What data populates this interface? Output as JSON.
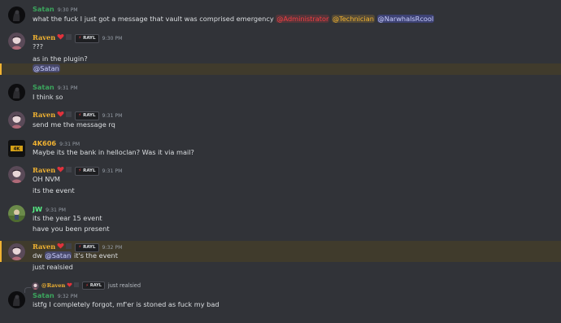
{
  "colors": {
    "background": "#313338",
    "text": "#dbdee1",
    "timestamp": "#949ba4",
    "satan": "#3ba55d",
    "raven": "#f0b232",
    "k606": "#f0b232",
    "jw": "#57f287",
    "highlight_bg": "#403b2c",
    "highlight_bar": "#f0b232",
    "mention_red": "#f23f43",
    "mention_yellow": "#f0b232",
    "mention_blue": "#c9cdfb"
  },
  "messages": [
    {
      "author": "Satan",
      "time": "9:30 PM",
      "lines": [
        "what the fuck I just got a message that vault was comprised emergency"
      ],
      "mentions": [
        "@Administrator",
        "@Technician",
        "@NarwhalsRcool"
      ]
    },
    {
      "author": "Raven",
      "tag": "RAYL",
      "time": "9:30 PM",
      "lines": [
        "???",
        "as in the plugin?"
      ],
      "mention_line": "@Satan"
    },
    {
      "author": "Satan",
      "time": "9:31 PM",
      "lines": [
        "I think so"
      ]
    },
    {
      "author": "Raven",
      "tag": "RAYL",
      "time": "9:31 PM",
      "lines": [
        "send me the message rq"
      ]
    },
    {
      "author": "4K606",
      "time": "9:31 PM",
      "lines": [
        "Maybe its the bank in helloclan? Was it via mail?"
      ]
    },
    {
      "author": "Raven",
      "tag": "RAYL",
      "time": "9:31 PM",
      "lines": [
        "OH NVM",
        "its the event"
      ]
    },
    {
      "author": "JW",
      "time": "9:31 PM",
      "lines": [
        "its the year 15 event",
        "have you been present"
      ]
    },
    {
      "author": "Raven",
      "tag": "RAYL",
      "time": "9:32 PM",
      "line1_prefix": "dw",
      "line1_mention": "@Satan",
      "line1_suffix": "it's the event",
      "lines": [
        "just realsied"
      ]
    },
    {
      "author": "Satan",
      "time": "9:32 PM",
      "reply": {
        "author": "@Raven",
        "tag": "RAYL",
        "text": "just realsied"
      },
      "lines": [
        "istfg I completely forgot, mf'er is stoned as fuck my bad"
      ]
    }
  ],
  "avatar_text": {
    "k606": "4K"
  }
}
